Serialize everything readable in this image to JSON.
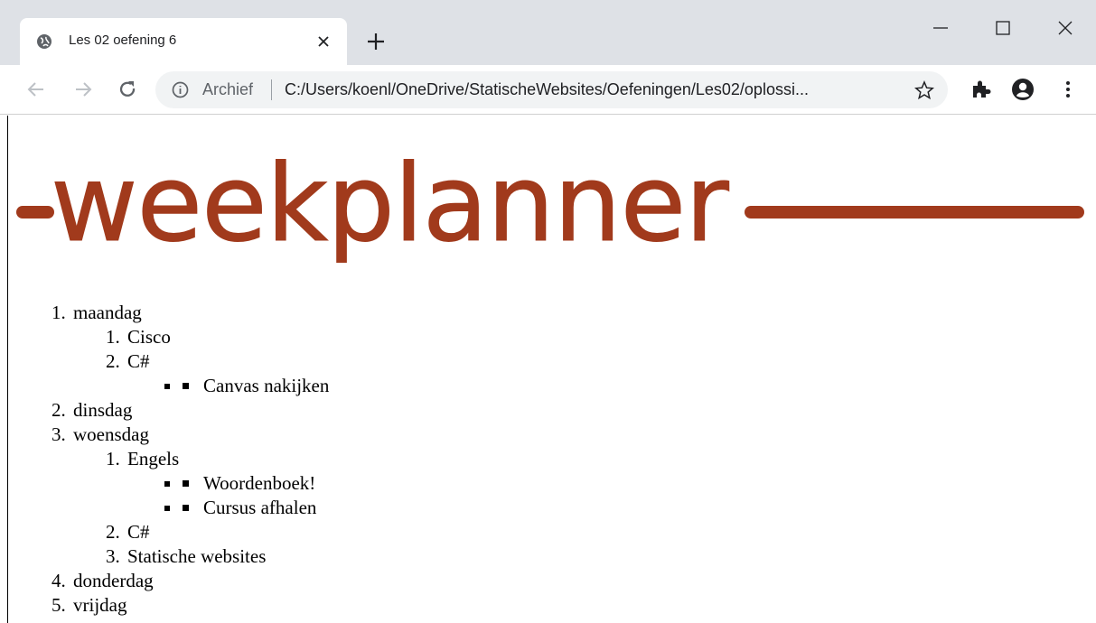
{
  "browser": {
    "tab": {
      "title": "Les 02 oefening 6",
      "favicon": "globe-icon"
    },
    "address_bar": {
      "security_label": "Archief",
      "url": "C:/Users/koenl/OneDrive/StatischeWebsites/Oefeningen/Les02/oplossi..."
    },
    "icons": [
      "back-arrow-icon",
      "forward-arrow-icon",
      "reload-icon",
      "info-icon",
      "star-icon",
      "puzzle-icon",
      "account-icon",
      "kebab-menu-icon",
      "minimize-icon",
      "maximize-icon",
      "close-icon",
      "plus-icon"
    ]
  },
  "page": {
    "banner_text": "weekplanner",
    "colors": {
      "brand": "#a13a1c",
      "text": "#000000",
      "tabstrip": "#dee1e6",
      "omnibox": "#f1f3f4"
    },
    "days": [
      {
        "num": "1.",
        "label": "maandag",
        "courses": [
          {
            "num": "1.",
            "label": "Cisco",
            "tasks": []
          },
          {
            "num": "2.",
            "label": "C#",
            "tasks": [
              "Canvas nakijken"
            ]
          }
        ]
      },
      {
        "num": "2.",
        "label": "dinsdag",
        "courses": []
      },
      {
        "num": "3.",
        "label": "woensdag",
        "courses": [
          {
            "num": "1.",
            "label": "Engels",
            "tasks": [
              "Woordenboek!",
              "Cursus afhalen"
            ]
          },
          {
            "num": "2.",
            "label": "C#",
            "tasks": []
          },
          {
            "num": "3.",
            "label": "Statische websites",
            "tasks": []
          }
        ]
      },
      {
        "num": "4.",
        "label": "donderdag",
        "courses": []
      },
      {
        "num": "5.",
        "label": "vrijdag",
        "courses": []
      }
    ]
  }
}
